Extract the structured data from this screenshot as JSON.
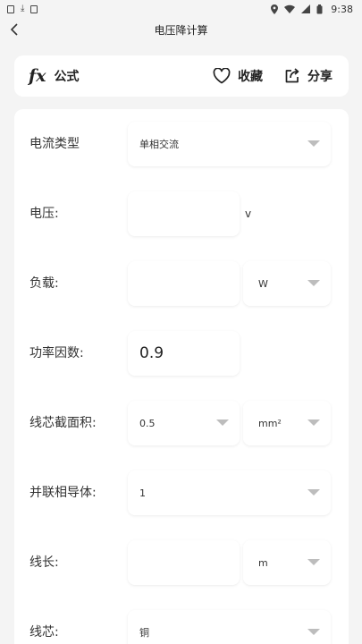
{
  "status_bar": {
    "time": "9:38"
  },
  "nav": {
    "title": "电压降计算"
  },
  "top_card": {
    "formula_icon": "fx",
    "formula_label": "公式",
    "favorite_label": "收藏",
    "share_label": "分享"
  },
  "form": {
    "current_type": {
      "label": "电流类型",
      "value": "单相交流"
    },
    "voltage": {
      "label": "电压:",
      "value": "",
      "unit": "v"
    },
    "load": {
      "label": "负载:",
      "value": "",
      "unit": "W"
    },
    "power_factor": {
      "label": "功率因数:",
      "value": "0.9"
    },
    "core_section": {
      "label": "线芯截面积:",
      "value": "0.5",
      "unit": "mm²"
    },
    "parallel_conductors": {
      "label": "并联相导体:",
      "value": "1"
    },
    "line_length": {
      "label": "线长:",
      "value": "",
      "unit": "m"
    },
    "core_material": {
      "label": "线芯:",
      "value": "铜"
    }
  }
}
